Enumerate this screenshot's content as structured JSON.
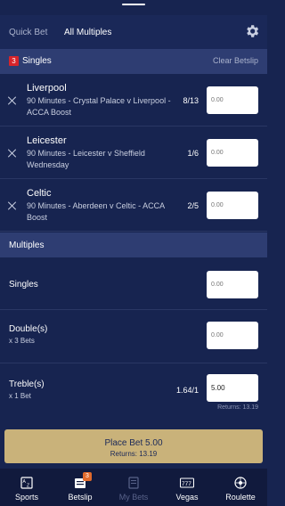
{
  "topbar": {
    "tabs": [
      {
        "label": "Quick Bet",
        "active": false
      },
      {
        "label": "All Multiples",
        "active": true
      }
    ],
    "settings_icon": "gear-icon"
  },
  "singles_section": {
    "count": "3",
    "title": "Singles",
    "clear_label": "Clear Betslip"
  },
  "bets": [
    {
      "selection": "Liverpool",
      "market": "90 Minutes - Crystal Palace v Liverpool - ACCA Boost",
      "odds": "8/13",
      "stake_placeholder": "0.00"
    },
    {
      "selection": "Leicester",
      "market": "90 Minutes - Leicester v Sheffield Wednesday",
      "odds": "1/6",
      "stake_placeholder": "0.00"
    },
    {
      "selection": "Celtic",
      "market": "90 Minutes - Aberdeen v Celtic - ACCA Boost",
      "odds": "2/5",
      "stake_placeholder": "0.00"
    }
  ],
  "multiples_section": {
    "title": "Multiples"
  },
  "multiples": [
    {
      "name": "Singles",
      "sub": "",
      "odds": "",
      "stake_placeholder": "0.00",
      "stake_value": "",
      "returns": ""
    },
    {
      "name": "Double(s)",
      "sub": "x 3 Bets",
      "odds": "",
      "stake_placeholder": "0.00",
      "stake_value": "",
      "returns": ""
    },
    {
      "name": "Treble(s)",
      "sub": "x 1 Bet",
      "odds": "1.64/1",
      "stake_placeholder": "0.00",
      "stake_value": "5.00",
      "returns": "Returns: 13.19"
    }
  ],
  "place_bet": {
    "label": "Place Bet 5.00",
    "returns": "Returns: 13.19",
    "color": "#c9b27a"
  },
  "bottom_nav": [
    {
      "label": "Sports",
      "icon": "az-sports-icon",
      "enabled": true
    },
    {
      "label": "Betslip",
      "icon": "betslip-icon",
      "badge": "3",
      "enabled": true
    },
    {
      "label": "My Bets",
      "icon": "my-bets-icon",
      "enabled": false
    },
    {
      "label": "Vegas",
      "icon": "slot-machine-icon",
      "enabled": true
    },
    {
      "label": "Roulette",
      "icon": "roulette-icon",
      "enabled": true
    }
  ],
  "colors": {
    "background": "#172450",
    "section_header": "#2e3d72",
    "nav_background": "#111a3d",
    "count_badge": "#d8242a"
  }
}
